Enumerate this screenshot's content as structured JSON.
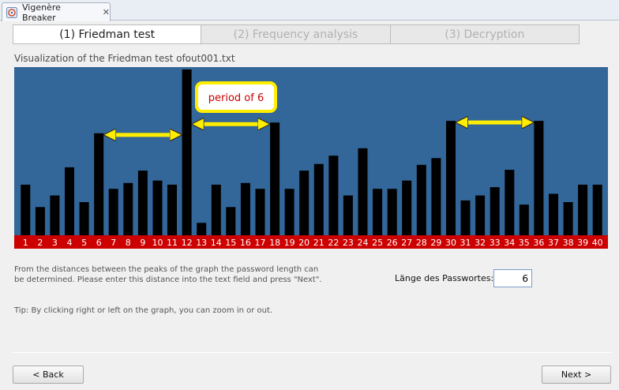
{
  "window": {
    "tab_title": "Vigenère Breaker",
    "close_glyph": "✕"
  },
  "steps": [
    {
      "label": "(1) Friedman test",
      "active": true
    },
    {
      "label": "(2) Frequency analysis",
      "active": false
    },
    {
      "label": "(3) Decryption",
      "active": false
    }
  ],
  "chart_title": "Visualization of the Friedman test ofout001.txt",
  "chart_data": {
    "type": "bar",
    "categories": [
      "1",
      "2",
      "3",
      "4",
      "5",
      "6",
      "7",
      "8",
      "9",
      "10",
      "11",
      "12",
      "13",
      "14",
      "15",
      "16",
      "17",
      "18",
      "19",
      "20",
      "21",
      "22",
      "23",
      "24",
      "25",
      "26",
      "27",
      "28",
      "29",
      "30",
      "31",
      "32",
      "33",
      "34",
      "35",
      "36",
      "37",
      "38",
      "39",
      "40"
    ],
    "values": [
      61,
      34,
      48,
      82,
      40,
      123,
      56,
      63,
      78,
      66,
      61,
      200,
      15,
      61,
      34,
      63,
      56,
      136,
      56,
      78,
      86,
      96,
      48,
      105,
      56,
      56,
      66,
      85,
      93,
      138,
      42,
      48,
      58,
      79,
      37,
      138,
      50,
      40,
      61,
      61
    ],
    "ylim": [
      0,
      200
    ],
    "background": "#336699",
    "bar_color": "#000000",
    "axis_band_color": "#cc0000",
    "axis_label_color": "#ffffff",
    "annotation": {
      "text": "period of 6",
      "text_color": "#cc0000",
      "border_color": "#ffee00",
      "arrow_color": "#ffee00"
    },
    "arrows": [
      {
        "from": 6,
        "to": 12
      },
      {
        "from": 12,
        "to": 18
      },
      {
        "from": 30,
        "to": 36
      }
    ]
  },
  "explanation": "From the distances between the peaks of the graph the password length can be determined. Please enter this distance into the text field and press \"Next\".",
  "tip": "Tip: By clicking right or left on the graph, you can zoom in or out.",
  "password_length": {
    "label": "Länge des Passwortes:",
    "value": "6"
  },
  "buttons": {
    "back": "< Back",
    "next": "Next >"
  }
}
